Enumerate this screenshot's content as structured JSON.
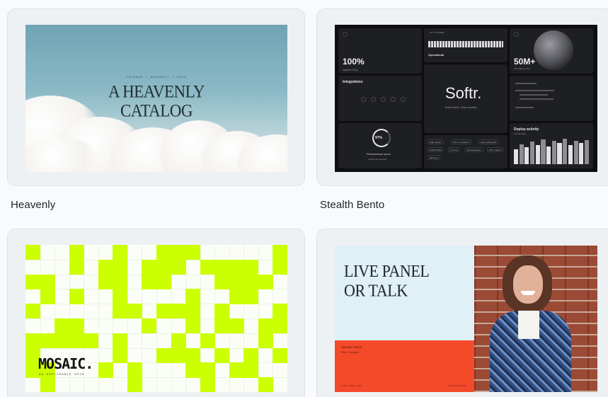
{
  "templates": [
    {
      "caption": "Heavenly",
      "kicker": "FRIENDS / HEAVENLY / 2025",
      "title_line1": "A HEAVENLY",
      "title_line2": "CATALOG"
    },
    {
      "caption": "Stealth Bento",
      "stat1": "100%",
      "stat1_sub": "Uptime SLA",
      "status_label": "ALL SYSTEMS",
      "operational": "Operational",
      "stat2": "50M+",
      "stat2_sub": "API calls per day",
      "integrations": "Integrations",
      "brand": "Softr.",
      "tagline": "Build faster. Ship smarter.",
      "perf_value": "97%",
      "perf_label": "Performance score",
      "perf_sub": "Lighthouse average",
      "deploy_label": "Deploy activity",
      "deploy_sub": "Last 30 days",
      "chips": [
        "Edge deploy",
        "SOC 2 compliant",
        "Auto-scaling DB",
        "Global CDN",
        "AI tools",
        "99 integrations",
        "24/7 support",
        "API keys"
      ],
      "deploy_values": [
        0.55,
        0.75,
        0.62,
        0.85,
        0.7,
        0.92,
        0.66,
        0.88,
        0.78,
        0.95,
        0.72,
        0.86,
        0.8,
        0.9
      ]
    },
    {
      "caption": "",
      "title": "MOSAIC.",
      "subtitle": "AN EXPLORABLE DECK"
    },
    {
      "caption": "",
      "title_line1": "LIVE PANEL",
      "title_line2": "OR TALK",
      "speaker_name": "Speaker Name",
      "speaker_role": "Role / Company",
      "footer_left": "EVENT NAME · 2025",
      "footer_right": "SPEAKER SERIES"
    }
  ],
  "colors": {
    "mosaic_accent": "#ccff00",
    "live_red": "#f44a2a",
    "live_blue": "#dff0f6"
  }
}
